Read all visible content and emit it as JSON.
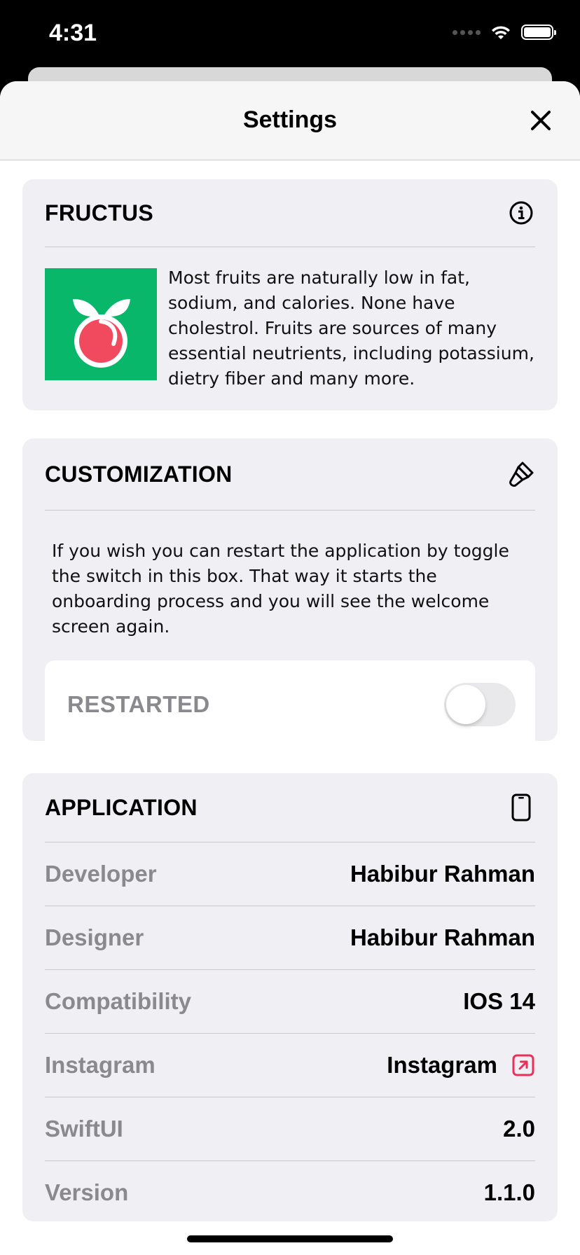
{
  "status_bar": {
    "time": "4:31"
  },
  "nav": {
    "title": "Settings",
    "close_icon": "close-icon"
  },
  "fructus": {
    "title": "FRUCTUS",
    "icon": "info-icon",
    "logo_color": "#09b76b",
    "description": "Most fruits are naturally low in fat, sodium, and calories. None have cholestrol. Fruits are sources of many essential neutrients, including potassium, dietry fiber and many more."
  },
  "customization": {
    "title": "CUSTOMIZATION",
    "icon": "paintbrush-icon",
    "description": "If you wish you can restart the application by toggle the switch in this box. That way it starts the onboarding process and you will see the welcome screen again.",
    "toggle_label": "RESTARTED",
    "toggle_on": false
  },
  "application": {
    "title": "APPLICATION",
    "icon": "iphone-icon",
    "rows": [
      {
        "key": "Developer",
        "value": "Habibur Rahman"
      },
      {
        "key": "Designer",
        "value": "Habibur Rahman"
      },
      {
        "key": "Compatibility",
        "value": "IOS 14"
      },
      {
        "key": "Instagram",
        "value": "Instagram",
        "link_icon": "external-link-icon",
        "link_color": "#e8305a"
      },
      {
        "key": "SwiftUI",
        "value": "2.0"
      },
      {
        "key": "Version",
        "value": "1.1.0"
      }
    ]
  }
}
